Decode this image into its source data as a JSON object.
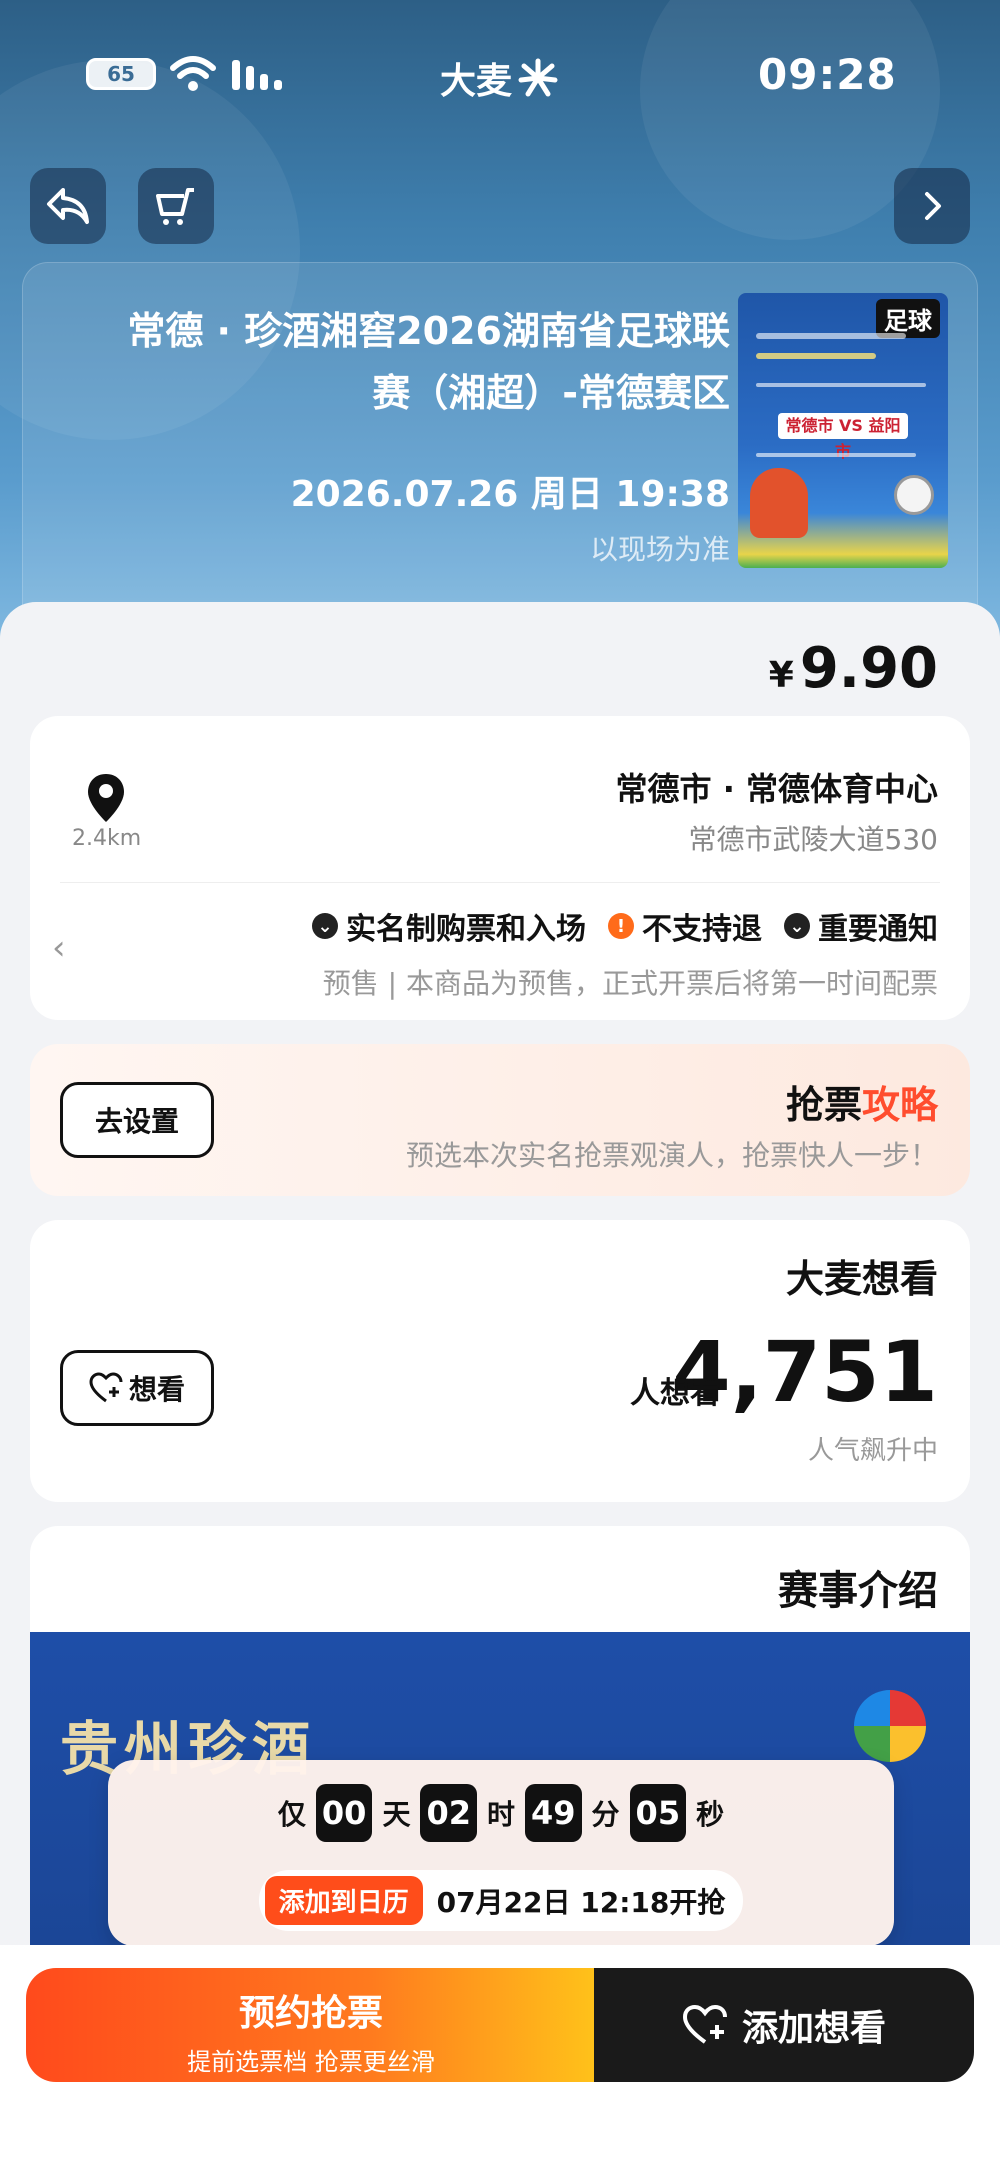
{
  "status": {
    "time": "09:28",
    "logo": "大麦",
    "battery": "65"
  },
  "event": {
    "title": "常德 · 珍酒湘窖2026湖南省足球联赛（湘超）-常德赛区",
    "date": "2026.07.26 周日 19:38",
    "note": "以现场为准",
    "poster_tag": "足球",
    "poster_vs": "常德市 VS 益阳市"
  },
  "price": {
    "currency": "¥",
    "amount": "9.90"
  },
  "venue": {
    "name": "常德市 · 常德体育中心",
    "address": "常德市武陵大道530",
    "distance": "2.4km"
  },
  "notices": {
    "items": [
      {
        "label": "重要通知",
        "icon": "chevron-down-icon"
      },
      {
        "label": "不支持退",
        "icon": "exclamation-icon"
      },
      {
        "label": "实名制购票和入场",
        "icon": "chevron-down-icon"
      }
    ],
    "sub": "预售 | 本商品为预售，正式开票后将第一时间配票"
  },
  "strategy": {
    "title_a": "抢票",
    "title_b": "攻略",
    "sub": "预选本次实名抢票观演人，抢票快人一步！",
    "button": "去设置"
  },
  "want": {
    "title": "大麦想看",
    "count": "4,751",
    "unit": "人想看",
    "sub": "人气飙升中",
    "button": "想看"
  },
  "intro": {
    "title": "赛事介绍",
    "banner_brand": "贵州珍酒"
  },
  "countdown": {
    "prefix": "仅",
    "days": "00",
    "days_unit": "天",
    "hours": "02",
    "hours_unit": "时",
    "minutes": "49",
    "minutes_unit": "分",
    "seconds": "05",
    "seconds_unit": "秒",
    "open_time": "07月22日 12:18开抢",
    "calendar_button": "添加到日历"
  },
  "bottom": {
    "want_button": "添加想看",
    "book_title": "预约抢票",
    "book_sub": "提前选票档 抢票更丝滑"
  },
  "colors": {
    "accent": "#ff4d1a",
    "hero": "#3f7fae"
  }
}
